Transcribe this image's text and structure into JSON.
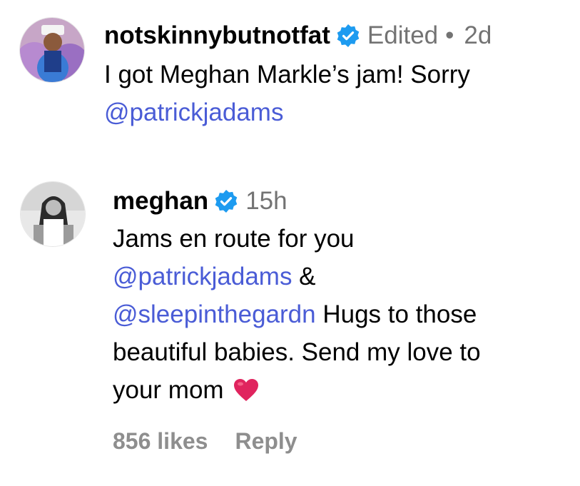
{
  "comments": [
    {
      "username": "notskinnybutnotfat",
      "edited": "Edited",
      "separator": "•",
      "time": "2d",
      "text_line1": "I got Meghan Markle’s jam! Sorry",
      "mention1": "@patrickjadams"
    },
    {
      "username": "meghan",
      "time": "15h",
      "line1": "Jams en route for you",
      "mention1": "@patrickjadams",
      "amp": " &",
      "mention2": "@sleepinthegardn",
      "line3_rest": " Hugs to those",
      "line4": "beautiful babies. Send my love to",
      "line5": "your mom ",
      "likes": "856 likes",
      "reply": "Reply"
    }
  ],
  "colors": {
    "mention": "#4a5cd6",
    "verified": "#1d9bf0",
    "muted": "#737373",
    "heart": "#e0245e"
  },
  "icons": [
    "verified-badge-icon",
    "heart-emoji-icon"
  ]
}
